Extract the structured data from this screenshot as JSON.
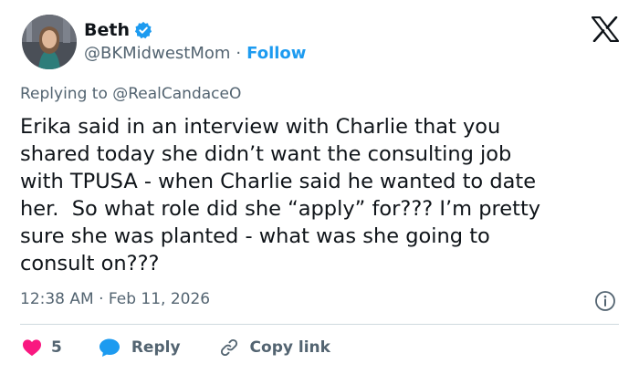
{
  "author": {
    "name": "Beth",
    "handle": "@BKMidwestMom",
    "separator": "·",
    "follow_label": "Follow"
  },
  "replying_to": {
    "prefix": "Replying to",
    "mention": "@RealCandaceO"
  },
  "tweet": {
    "lines": [
      "Erika said in an interview with Charlie that you",
      "shared today she didn’t want the consulting job",
      "with TPUSA - when Charlie said he wanted to date",
      "her.  So what role did she “apply” for??? I’m pretty",
      "sure she was planted - what was she going to",
      "consult on???"
    ]
  },
  "meta": {
    "time": "12:38 AM",
    "separator": "·",
    "date": "Feb 11, 2026"
  },
  "actions": {
    "like_count": "5",
    "reply_label": "Reply",
    "copy_link_label": "Copy link"
  },
  "colors": {
    "accent": "#1d9bf0",
    "like": "#f91880",
    "muted": "#536471",
    "text": "#0f1419"
  },
  "icons": [
    "verified-badge-icon",
    "x-logo-icon",
    "info-icon",
    "heart-icon",
    "reply-bubble-icon",
    "link-icon"
  ]
}
